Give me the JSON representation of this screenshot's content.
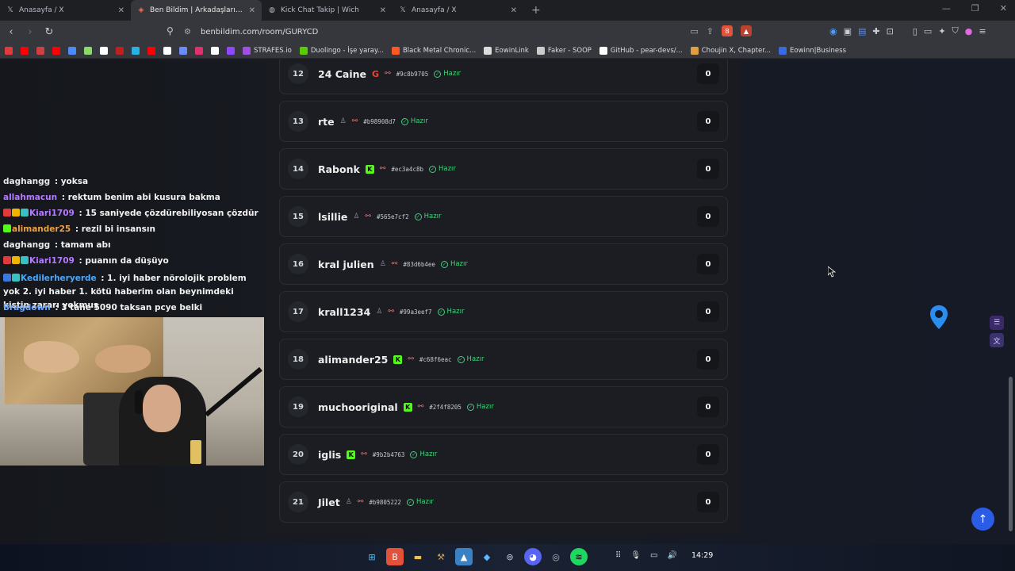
{
  "tabs": [
    {
      "title": "Anasayfa / X",
      "icon": "x-logo-icon",
      "active": false
    },
    {
      "title": "Ben Bildim | Arkadaşlarınla Online",
      "icon": "benbildim-favicon-icon",
      "active": true
    },
    {
      "title": "Kick Chat Takip | Wich",
      "icon": "globe-icon",
      "active": false
    },
    {
      "title": "Anasayfa / X",
      "icon": "x-logo-icon",
      "active": false
    }
  ],
  "url": "benbildim.com/room/GURYCD",
  "bookmarks": [
    {
      "label": "",
      "color": "#e23a3a"
    },
    {
      "label": "",
      "color": "#ff0000"
    },
    {
      "label": "",
      "color": "#d04040"
    },
    {
      "label": "",
      "color": "#ff0000"
    },
    {
      "label": "",
      "color": "#4d8cff"
    },
    {
      "label": "",
      "color": "#8bd96b"
    },
    {
      "label": "",
      "color": "#ffffff"
    },
    {
      "label": "",
      "color": "#c02020"
    },
    {
      "label": "",
      "color": "#2bb0e6"
    },
    {
      "label": "",
      "color": "#ff0000"
    },
    {
      "label": "",
      "color": "#ffffff"
    },
    {
      "label": "",
      "color": "#6a8cff"
    },
    {
      "label": "",
      "color": "#e1306c"
    },
    {
      "label": "",
      "color": "#ffffff"
    },
    {
      "label": "",
      "color": "#9146ff"
    },
    {
      "label": "STRAFES.io",
      "color": "#a050e0"
    },
    {
      "label": "Duolingo - İşe yaray...",
      "color": "#58cc02"
    },
    {
      "label": "Black Metal Chronic...",
      "color": "#ff5722"
    },
    {
      "label": "EowinLink",
      "color": "#dddddd"
    },
    {
      "label": "Faker - SOOP",
      "color": "#cccccc"
    },
    {
      "label": "GitHub - pear-devs/...",
      "color": "#ffffff"
    },
    {
      "label": "Choujin X, Chapter...",
      "color": "#e0a040"
    },
    {
      "label": "Eowinn|Business",
      "color": "#3a6ae0"
    }
  ],
  "chat": [
    {
      "user": "daghangg",
      "user_color": "#e8e8e8",
      "message": "yoksa",
      "badges": []
    },
    {
      "user": "allahmacun",
      "user_color": "#b57bff",
      "message": "rektum benim abi kusura bakma",
      "badges": []
    },
    {
      "user": "Kiari1709",
      "user_color": "#b57bff",
      "message": "15 saniyede çözdürebiliyosan çözdür",
      "badges": [
        "#e23a3a",
        "#f0b400",
        "#3ac0c0"
      ]
    },
    {
      "user": "alimander25",
      "user_color": "#f0a040",
      "message": "rezil bi insansın",
      "badges": [
        "#53fc18"
      ]
    },
    {
      "user": "daghangg",
      "user_color": "#e8e8e8",
      "message": "tamam abı",
      "badges": []
    },
    {
      "user": "Kiari1709",
      "user_color": "#b57bff",
      "message": "puanın da düşüyo",
      "badges": [
        "#e23a3a",
        "#f0b400",
        "#3ac0c0"
      ]
    },
    {
      "user": "Kedilerheryerde",
      "user_color": "#4aa8ff",
      "message": "1. iyi haber nörolojik problem yok 2. iyi haber 1. kötü haberim olan beynimdeki kistin zararı yokmuş",
      "badges": [
        "#3a7ae0",
        "#3ac0c0"
      ]
    },
    {
      "user": "Bragdown",
      "user_color": "#6fa8ff",
      "message": "3 tane 5090 taksan pcye belki",
      "badges": []
    }
  ],
  "players": [
    {
      "rank": "12",
      "name": "24 Caine",
      "provider": "google",
      "hash": "#9c8b9705",
      "status": "Hazır",
      "score": "0"
    },
    {
      "rank": "13",
      "name": "rte",
      "provider": "user",
      "hash": "#b98908d7",
      "status": "Hazır",
      "score": "0"
    },
    {
      "rank": "14",
      "name": "Rabonk",
      "provider": "kick",
      "hash": "#ec3a4c8b",
      "status": "Hazır",
      "score": "0"
    },
    {
      "rank": "15",
      "name": "lsillie",
      "provider": "user",
      "hash": "#565e7cf2",
      "status": "Hazır",
      "score": "0"
    },
    {
      "rank": "16",
      "name": "kral julien",
      "provider": "user",
      "hash": "#83d6b4ee",
      "status": "Hazır",
      "score": "0"
    },
    {
      "rank": "17",
      "name": "krall1234",
      "provider": "user",
      "hash": "#99a3eef7",
      "status": "Hazır",
      "score": "0"
    },
    {
      "rank": "18",
      "name": "alimander25",
      "provider": "kick",
      "hash": "#c68f6eac",
      "status": "Hazır",
      "score": "0"
    },
    {
      "rank": "19",
      "name": "muchooriginal",
      "provider": "kick",
      "hash": "#2f4f8205",
      "status": "Hazır",
      "score": "0"
    },
    {
      "rank": "20",
      "name": "iglis",
      "provider": "kick",
      "hash": "#9b2b4763",
      "status": "Hazır",
      "score": "0"
    },
    {
      "rank": "21",
      "name": "Jilet",
      "provider": "user",
      "hash": "#b9805222",
      "status": "Hazır",
      "score": "0"
    }
  ],
  "taskbar": {
    "clock": "14:29"
  },
  "colors": {
    "accent": "#2b5ce6",
    "ready": "#3ed47a",
    "kick": "#53fc18"
  }
}
